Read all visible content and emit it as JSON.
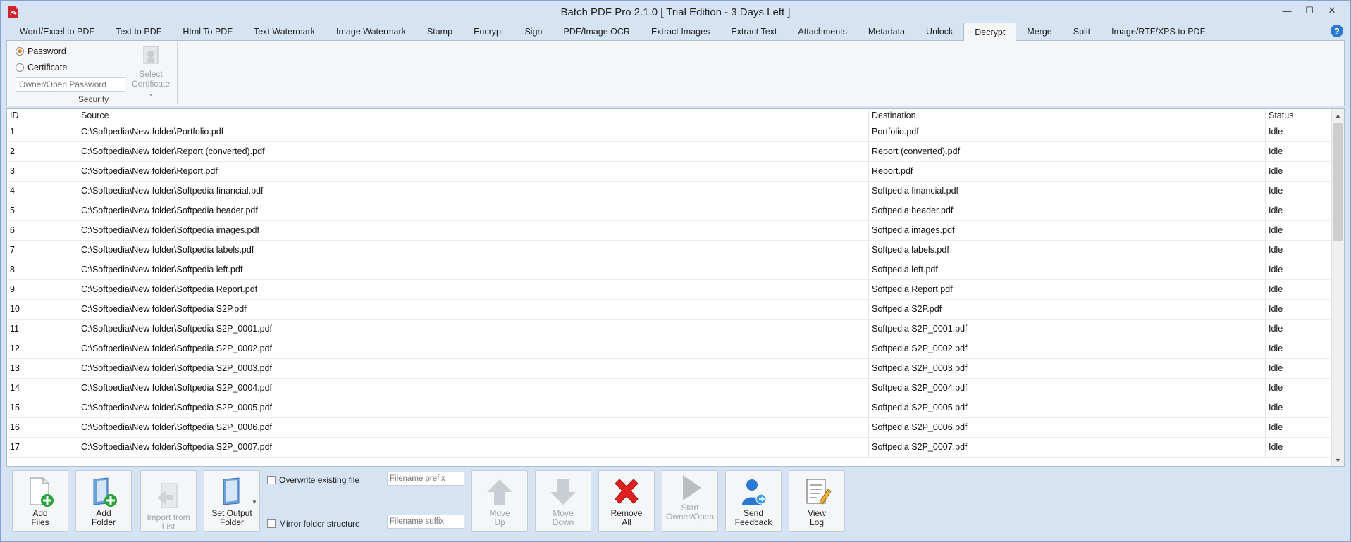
{
  "window": {
    "title": "Batch PDF Pro 2.1.0 [ Trial Edition - 3 Days Left ]",
    "minimize": "—",
    "maximize": "☐",
    "close": "✕"
  },
  "tabs": [
    "Word/Excel to PDF",
    "Text to PDF",
    "Html To PDF",
    "Text Watermark",
    "Image Watermark",
    "Stamp",
    "Encrypt",
    "Sign",
    "PDF/Image OCR",
    "Extract Images",
    "Extract Text",
    "Attachments",
    "Metadata",
    "Unlock",
    "Decrypt",
    "Merge",
    "Split",
    "Image/RTF/XPS to PDF"
  ],
  "active_tab": "Decrypt",
  "help_label": "?",
  "security": {
    "password_label": "Password",
    "certificate_label": "Certificate",
    "password_placeholder": "Owner/Open Password",
    "select_cert_line1": "Select",
    "select_cert_line2": "Certificate",
    "group_label": "Security"
  },
  "grid": {
    "columns": [
      "ID",
      "Source",
      "Destination",
      "Status"
    ],
    "rows": [
      [
        "1",
        "C:\\Softpedia\\New folder\\Portfolio.pdf",
        "Portfolio.pdf",
        "Idle"
      ],
      [
        "2",
        "C:\\Softpedia\\New folder\\Report (converted).pdf",
        "Report (converted).pdf",
        "Idle"
      ],
      [
        "3",
        "C:\\Softpedia\\New folder\\Report.pdf",
        "Report.pdf",
        "Idle"
      ],
      [
        "4",
        "C:\\Softpedia\\New folder\\Softpedia financial.pdf",
        "Softpedia financial.pdf",
        "Idle"
      ],
      [
        "5",
        "C:\\Softpedia\\New folder\\Softpedia header.pdf",
        "Softpedia header.pdf",
        "Idle"
      ],
      [
        "6",
        "C:\\Softpedia\\New folder\\Softpedia images.pdf",
        "Softpedia images.pdf",
        "Idle"
      ],
      [
        "7",
        "C:\\Softpedia\\New folder\\Softpedia labels.pdf",
        "Softpedia labels.pdf",
        "Idle"
      ],
      [
        "8",
        "C:\\Softpedia\\New folder\\Softpedia left.pdf",
        "Softpedia left.pdf",
        "Idle"
      ],
      [
        "9",
        "C:\\Softpedia\\New folder\\Softpedia Report.pdf",
        "Softpedia Report.pdf",
        "Idle"
      ],
      [
        "10",
        "C:\\Softpedia\\New folder\\Softpedia S2P.pdf",
        "Softpedia S2P.pdf",
        "Idle"
      ],
      [
        "11",
        "C:\\Softpedia\\New folder\\Softpedia S2P_0001.pdf",
        "Softpedia S2P_0001.pdf",
        "Idle"
      ],
      [
        "12",
        "C:\\Softpedia\\New folder\\Softpedia S2P_0002.pdf",
        "Softpedia S2P_0002.pdf",
        "Idle"
      ],
      [
        "13",
        "C:\\Softpedia\\New folder\\Softpedia S2P_0003.pdf",
        "Softpedia S2P_0003.pdf",
        "Idle"
      ],
      [
        "14",
        "C:\\Softpedia\\New folder\\Softpedia S2P_0004.pdf",
        "Softpedia S2P_0004.pdf",
        "Idle"
      ],
      [
        "15",
        "C:\\Softpedia\\New folder\\Softpedia S2P_0005.pdf",
        "Softpedia S2P_0005.pdf",
        "Idle"
      ],
      [
        "16",
        "C:\\Softpedia\\New folder\\Softpedia S2P_0006.pdf",
        "Softpedia S2P_0006.pdf",
        "Idle"
      ],
      [
        "17",
        "C:\\Softpedia\\New folder\\Softpedia S2P_0007.pdf",
        "Softpedia S2P_0007.pdf",
        "Idle"
      ]
    ]
  },
  "toolbar": {
    "add_files": [
      "Add",
      "Files"
    ],
    "add_folder": [
      "Add",
      "Folder"
    ],
    "import_list": "Import from List",
    "set_output": [
      "Set Output",
      "Folder"
    ],
    "overwrite_label": "Overwrite existing file",
    "mirror_label": "Mirror folder structure",
    "prefix_placeholder": "Filename prefix",
    "suffix_placeholder": "Filename suffix",
    "move_up": [
      "Move",
      "Up"
    ],
    "move_down": [
      "Move",
      "Down"
    ],
    "remove_all": [
      "Remove",
      "All"
    ],
    "start": [
      "Start",
      "Owner/Open"
    ],
    "feedback": [
      "Send",
      "Feedback"
    ],
    "view_log": [
      "View",
      "Log"
    ]
  },
  "colors": {
    "chrome": "#d6e3f2",
    "accent_blue": "#2b78d0",
    "remove_red": "#e02020",
    "radio_orange": "#e5891d"
  }
}
